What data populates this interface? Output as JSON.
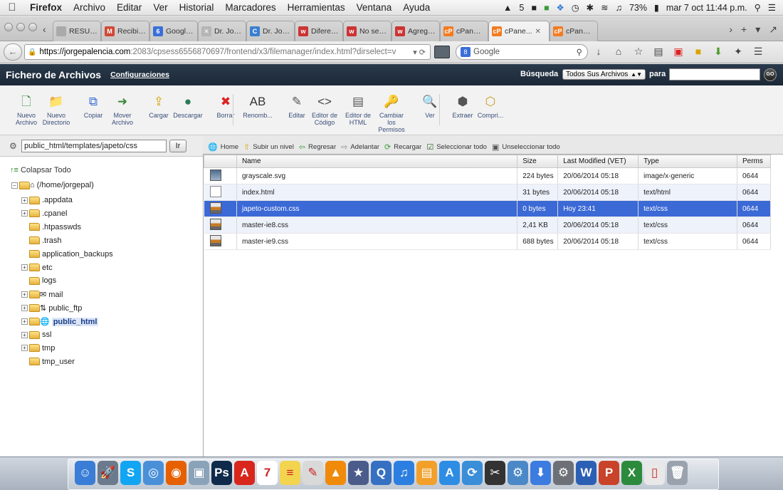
{
  "menubar": {
    "app": "Firefox",
    "items": [
      "Archivo",
      "Editar",
      "Ver",
      "Historial",
      "Marcadores",
      "Herramientas",
      "Ventana",
      "Ayuda"
    ],
    "status_battery": "73%",
    "clock": "mar 7 oct  11:44 p.m.",
    "badge_count": "5"
  },
  "tabs": [
    {
      "label": "RESUPU...",
      "icon": "doc-icon",
      "color": "#aaaaaa"
    },
    {
      "label": "Recibido...",
      "icon": "gmail-icon",
      "color": "#d14836"
    },
    {
      "label": "Google C...",
      "icon": "google-calendar-icon",
      "color": "#3a6fd8"
    },
    {
      "label": "Dr. Jorge...",
      "icon": "x-icon",
      "color": "#b5b5b5"
    },
    {
      "label": "Dr. Jorge...",
      "icon": "c-icon",
      "color": "#3a7fd1"
    },
    {
      "label": "Diferenci...",
      "icon": "w-icon",
      "color": "#cc3333"
    },
    {
      "label": "No se ve...",
      "icon": "w-icon",
      "color": "#cc3333"
    },
    {
      "label": "Agregar ...",
      "icon": "w-icon",
      "color": "#cc3333"
    },
    {
      "label": "cPanel X ...",
      "icon": "cpanel-icon",
      "color": "#f37b21"
    },
    {
      "label": "cPane...",
      "icon": "cpanel-icon",
      "color": "#f37b21",
      "active": true
    },
    {
      "label": "cPanel X ...",
      "icon": "cpanel-icon",
      "color": "#f37b21"
    }
  ],
  "nav": {
    "url_host": "https://jorgepalencia.com",
    "url_path": ":2083/cpsess6556870697/frontend/x3/filemanager/index.html?dirselect=v",
    "search_placeholder": "Google"
  },
  "cpanel": {
    "title": "Fichero de Archivos",
    "config_link": "Configuraciones",
    "search_label": "Búsqueda",
    "search_scope": "Todos Sus Archivos",
    "para_label": "para",
    "go_label": "GO"
  },
  "toolbar": [
    {
      "label": "Nuevo Archivo",
      "icon": "new-file-icon"
    },
    {
      "label": "Nuevo Directorio",
      "icon": "new-folder-icon"
    },
    {
      "label": "Copiar",
      "icon": "copy-icon"
    },
    {
      "label": "Mover Archivo",
      "icon": "move-icon"
    },
    {
      "label": "Cargar",
      "icon": "upload-icon"
    },
    {
      "label": "Descargar",
      "icon": "download-icon"
    },
    {
      "label": "Borrar",
      "icon": "delete-icon"
    },
    {
      "label": "Renomb...",
      "icon": "rename-icon"
    },
    {
      "label": "Editar",
      "icon": "edit-icon"
    },
    {
      "label": "Editor de Código",
      "icon": "code-editor-icon"
    },
    {
      "label": "Editor de HTML",
      "icon": "html-editor-icon"
    },
    {
      "label": "Cambiar los Permisos",
      "icon": "permissions-icon"
    },
    {
      "label": "Ver",
      "icon": "view-icon"
    },
    {
      "label": "Extraer",
      "icon": "extract-icon"
    },
    {
      "label": "Compri...",
      "icon": "compress-icon"
    }
  ],
  "path": {
    "value": "public_html/templates/japeto/css",
    "go_label": "Ir"
  },
  "actions": [
    {
      "label": "Home",
      "icon": "home-icon"
    },
    {
      "label": "Subir un nivel",
      "icon": "up-level-icon"
    },
    {
      "label": "Regresar",
      "icon": "back-arrow-icon"
    },
    {
      "label": "Adelantar",
      "icon": "forward-arrow-icon"
    },
    {
      "label": "Recargar",
      "icon": "reload-icon"
    },
    {
      "label": "Seleccionar todo",
      "icon": "checkbox-icon"
    },
    {
      "label": "Unseleccionar todo",
      "icon": "unchecked-icon"
    }
  ],
  "tree": {
    "collapse_label": "Colapsar Todo",
    "root": "(/home/jorgepal)",
    "items": [
      {
        "label": ".appdata",
        "expandable": true
      },
      {
        "label": ".cpanel",
        "expandable": true
      },
      {
        "label": ".htpasswds",
        "expandable": false
      },
      {
        "label": ".trash",
        "expandable": false
      },
      {
        "label": "application_backups",
        "expandable": false
      },
      {
        "label": "etc",
        "expandable": true
      },
      {
        "label": "logs",
        "expandable": false
      },
      {
        "label": "mail",
        "expandable": true,
        "overlay": "mail-icon"
      },
      {
        "label": "public_ftp",
        "expandable": true,
        "overlay": "ftp-icon"
      },
      {
        "label": "public_html",
        "expandable": true,
        "overlay": "globe-icon",
        "selected": true
      },
      {
        "label": "ssl",
        "expandable": true
      },
      {
        "label": "tmp",
        "expandable": true
      },
      {
        "label": "tmp_user",
        "expandable": false
      }
    ]
  },
  "files": {
    "columns": [
      "Name",
      "Size",
      "Last Modified (VET)",
      "Type",
      "Perms"
    ],
    "rows": [
      {
        "name": "grayscale.svg",
        "size": "224 bytes",
        "modified": "20/06/2014 05:18",
        "type": "image/x-generic",
        "perms": "0644",
        "icon": "image-file-icon"
      },
      {
        "name": "index.html",
        "size": "31 bytes",
        "modified": "20/06/2014 05:18",
        "type": "text/html",
        "perms": "0644",
        "icon": "html-file-icon"
      },
      {
        "name": "japeto-custom.css",
        "size": "0 bytes",
        "modified": "Hoy 23:41",
        "type": "text/css",
        "perms": "0644",
        "icon": "css-file-icon",
        "selected": true
      },
      {
        "name": "master-ie8.css",
        "size": "2,41 KB",
        "modified": "20/06/2014 05:18",
        "type": "text/css",
        "perms": "0644",
        "icon": "css-file-icon"
      },
      {
        "name": "master-ie9.css",
        "size": "688 bytes",
        "modified": "20/06/2014 05:18",
        "type": "text/css",
        "perms": "0644",
        "icon": "css-file-icon"
      }
    ]
  },
  "dock": [
    {
      "icon": "finder-icon",
      "color": "#3a7dd6",
      "glyph": "☺"
    },
    {
      "icon": "launchpad-icon",
      "color": "#6b7a8c",
      "glyph": "🚀"
    },
    {
      "icon": "skype-icon",
      "color": "#12a5f4",
      "glyph": "S"
    },
    {
      "icon": "safari-icon",
      "color": "#4a90d9",
      "glyph": "◎"
    },
    {
      "icon": "firefox-icon",
      "color": "#e66000",
      "glyph": "◉"
    },
    {
      "icon": "preview-icon",
      "color": "#8aa3b8",
      "glyph": "▣"
    },
    {
      "icon": "photoshop-icon",
      "color": "#0f2a4a",
      "glyph": "Ps"
    },
    {
      "icon": "acrobat-icon",
      "color": "#d8261d",
      "glyph": "A"
    },
    {
      "icon": "calendar-icon",
      "color": "#ffffff",
      "glyph": "7"
    },
    {
      "icon": "notes-icon",
      "color": "#f3d44f",
      "glyph": "≡"
    },
    {
      "icon": "textedit-icon",
      "color": "#d9d9d9",
      "glyph": "✎"
    },
    {
      "icon": "vlc-icon",
      "color": "#f08a0a",
      "glyph": "▲"
    },
    {
      "icon": "imovie-icon",
      "color": "#4b5c8a",
      "glyph": "★"
    },
    {
      "icon": "quicktime-icon",
      "color": "#3570c2",
      "glyph": "Q"
    },
    {
      "icon": "itunes-icon",
      "color": "#2c7fe0",
      "glyph": "♫"
    },
    {
      "icon": "ibooks-icon",
      "color": "#f2a02a",
      "glyph": "▤"
    },
    {
      "icon": "appstore-icon",
      "color": "#2d8de4",
      "glyph": "A"
    },
    {
      "icon": "sync-icon",
      "color": "#3a8ed8",
      "glyph": "⟳"
    },
    {
      "icon": "fcp-icon",
      "color": "#333333",
      "glyph": "✂"
    },
    {
      "icon": "migration-icon",
      "color": "#4b88c7",
      "glyph": "⚙"
    },
    {
      "icon": "download-icon",
      "color": "#3c7be0",
      "glyph": "⬇"
    },
    {
      "icon": "system-prefs-icon",
      "color": "#6d7177",
      "glyph": "⚙"
    },
    {
      "icon": "word-icon",
      "color": "#2b5fb4",
      "glyph": "W"
    },
    {
      "icon": "powerpoint-icon",
      "color": "#c9422a",
      "glyph": "P"
    },
    {
      "icon": "excel-icon",
      "color": "#2c8a3c",
      "glyph": "X"
    },
    {
      "icon": "document-icon",
      "color": "#e8e8e8",
      "glyph": "▯"
    },
    {
      "icon": "trash-icon",
      "color": "#9aa3ad",
      "glyph": "🗑"
    }
  ]
}
